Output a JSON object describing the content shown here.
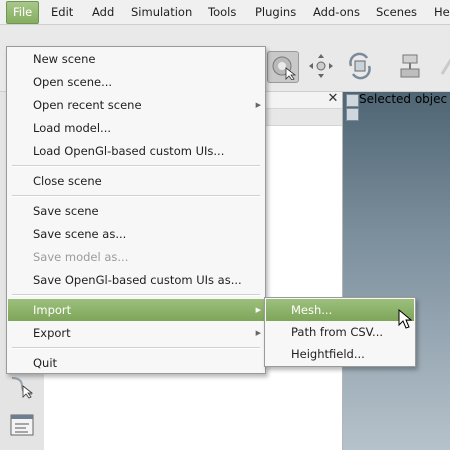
{
  "menubar": [
    "File",
    "Edit",
    "Add",
    "Simulation",
    "Tools",
    "Plugins",
    "Add-ons",
    "Scenes",
    "He"
  ],
  "file_menu": {
    "items": [
      "New scene",
      "Open scene...",
      "Open recent scene",
      "Load model...",
      "Load OpenGl-based custom UIs...",
      "Close scene",
      "Save scene",
      "Save scene as...",
      "Save model as...",
      "Save OpenGl-based custom UIs as...",
      "Import",
      "Export",
      "Quit"
    ]
  },
  "import_submenu": [
    "Mesh...",
    "Path from CSV...",
    "Heightfield..."
  ],
  "viewport": {
    "label": "Selected objec"
  },
  "colors": {
    "accent": "#86ad61"
  }
}
